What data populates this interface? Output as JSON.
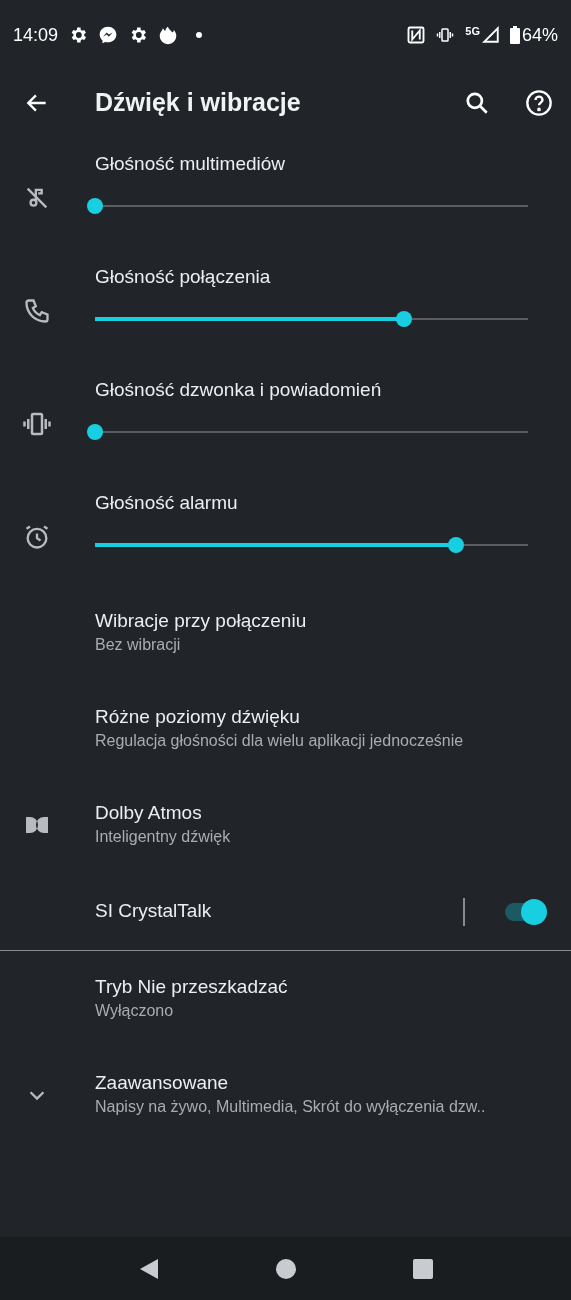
{
  "status_bar": {
    "time": "14:09",
    "network": "5G",
    "battery": "64%"
  },
  "header": {
    "title": "Dźwięk i wibracje"
  },
  "volume_sliders": [
    {
      "label": "Głośność multimediów",
      "level": 0
    },
    {
      "label": "Głośność połączenia",
      "level": 0.714
    },
    {
      "label": "Głośność dzwonka i powiadomień",
      "level": 0
    },
    {
      "label": "Głośność alarmu",
      "level": 0.834
    }
  ],
  "settings": [
    {
      "kind": "text",
      "title": "Wibracje przy połączeniu",
      "subtitle": "Bez wibracji"
    },
    {
      "kind": "text",
      "title": "Różne poziomy dźwięku",
      "subtitle": "Regulacja głośności dla wielu aplikacji jednocześnie"
    },
    {
      "kind": "text",
      "title": "Dolby Atmos",
      "subtitle": "Inteligentny dźwięk"
    },
    {
      "kind": "switch",
      "title": "SI CrystalTalk",
      "on": true
    },
    {
      "kind": "text",
      "title": "Tryb Nie przeszkadzać",
      "subtitle": "Wyłączono"
    },
    {
      "kind": "text",
      "title": "Zaawansowane",
      "subtitle": "Napisy na żywo, Multimedia, Skrót do wyłączenia dzw.."
    }
  ]
}
